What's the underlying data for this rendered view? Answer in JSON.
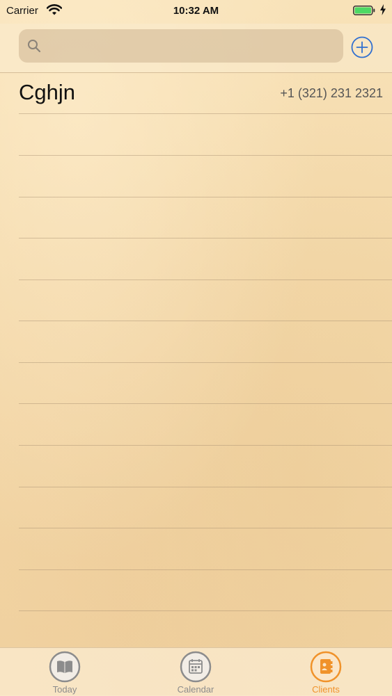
{
  "status_bar": {
    "carrier": "Carrier",
    "time": "10:32 AM"
  },
  "search": {
    "placeholder": ""
  },
  "clients": [
    {
      "name": "Cghjn",
      "phone": "+1 (321) 231 2321"
    }
  ],
  "tabs": [
    {
      "label": "Today",
      "active": false
    },
    {
      "label": "Calendar",
      "active": false
    },
    {
      "label": "Clients",
      "active": true
    }
  ],
  "colors": {
    "accent_blue": "#2f6fd0",
    "active_tab": "#f0922a",
    "inactive_tab": "#8c8c8c"
  }
}
